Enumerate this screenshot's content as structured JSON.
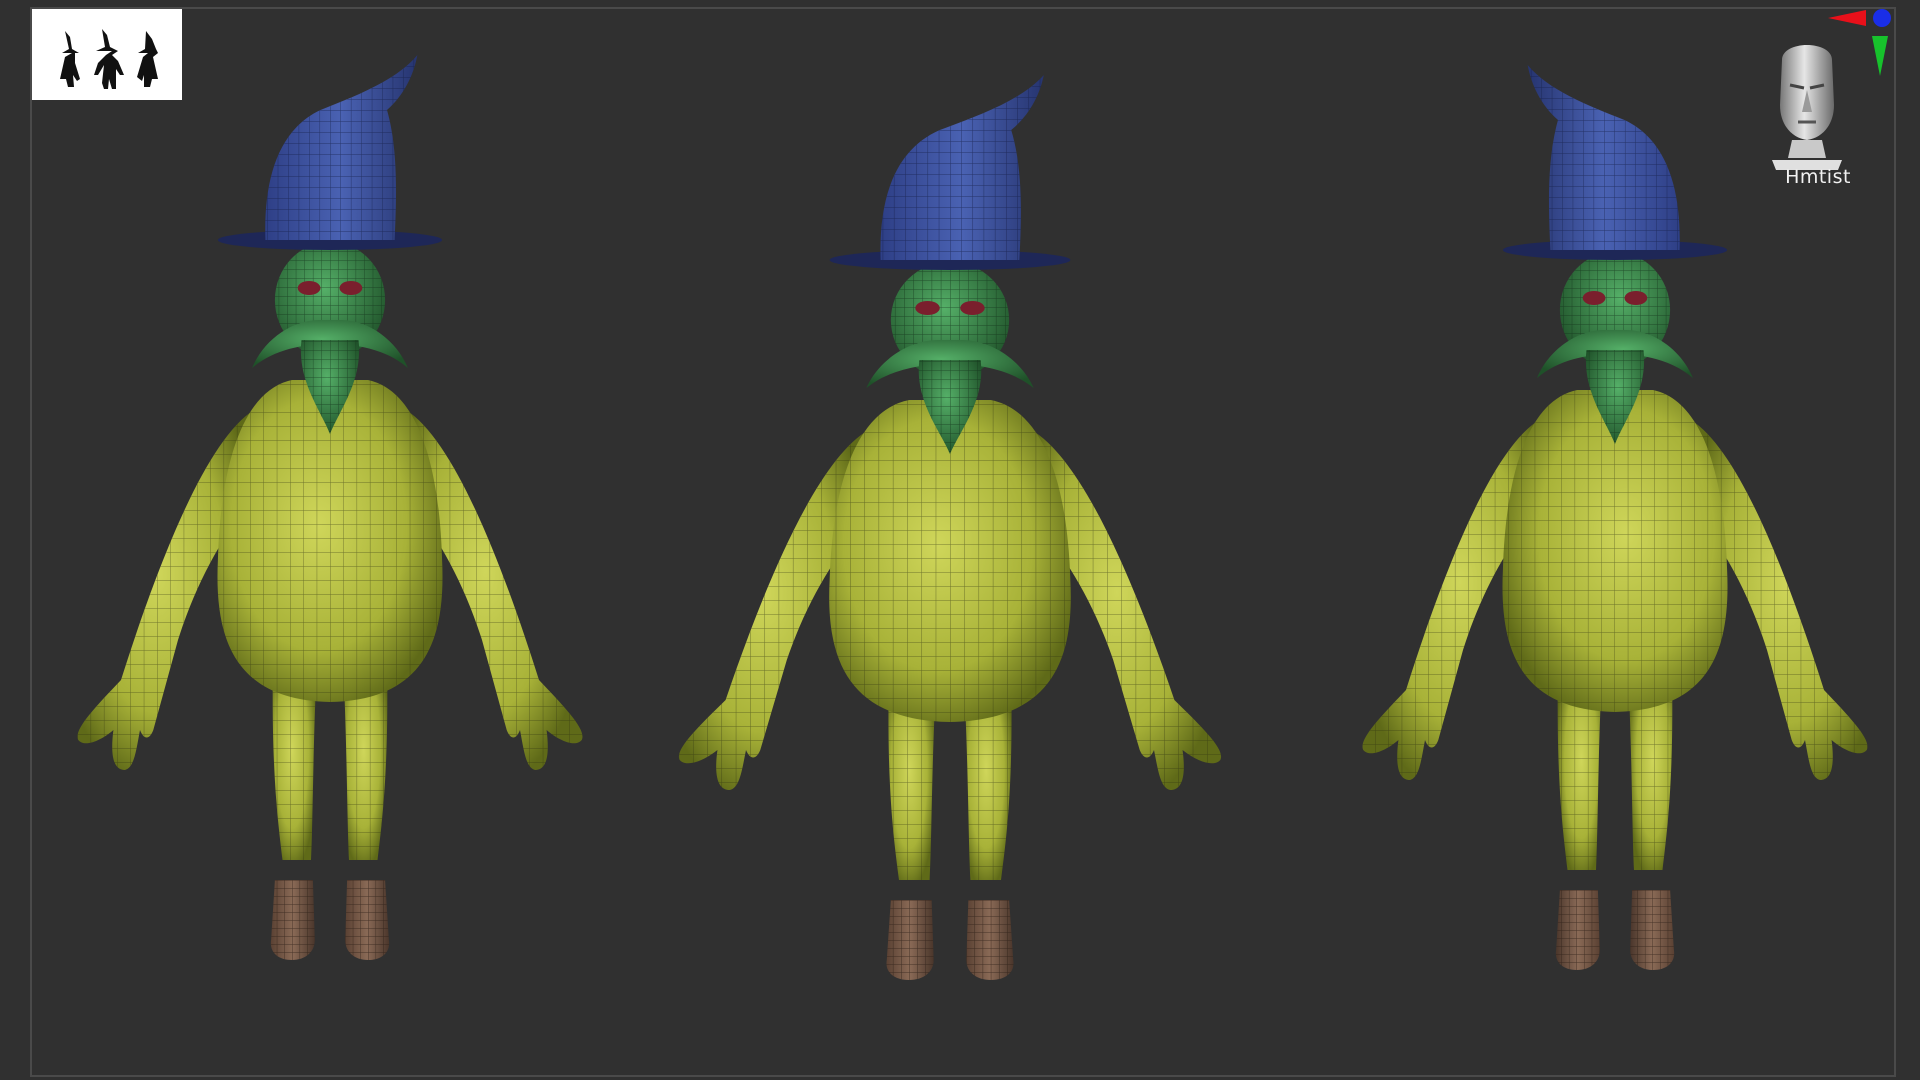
{
  "viewport": {
    "background": "#303030",
    "border_color": "#4a4a4a"
  },
  "thumbnail": {
    "icon": "character-silhouettes-icon",
    "background": "#ffffff",
    "silhouette_color": "#111111"
  },
  "nav_cube": {
    "label": "Hmtist",
    "icon": "head-navigation-icon"
  },
  "axis_gizmo": {
    "icon": "axis-gizmo-icon",
    "x_color": "#e8101a",
    "y_color": "#17c22c",
    "z_color": "#1a2ee8"
  },
  "model": {
    "views": [
      "three-quarter-left",
      "front",
      "three-quarter-right"
    ],
    "colors": {
      "body": "#b4bd40",
      "body_shadow": "#6f7a1e",
      "skin": "#3f9a52",
      "skin_shadow": "#235c30",
      "hat": "#4157a6",
      "hat_shadow": "#283776",
      "boots": "#7a5a48",
      "boots_shadow": "#4a362b",
      "eyes": "#7a1f2d",
      "wireframe": "#2c3010"
    }
  }
}
